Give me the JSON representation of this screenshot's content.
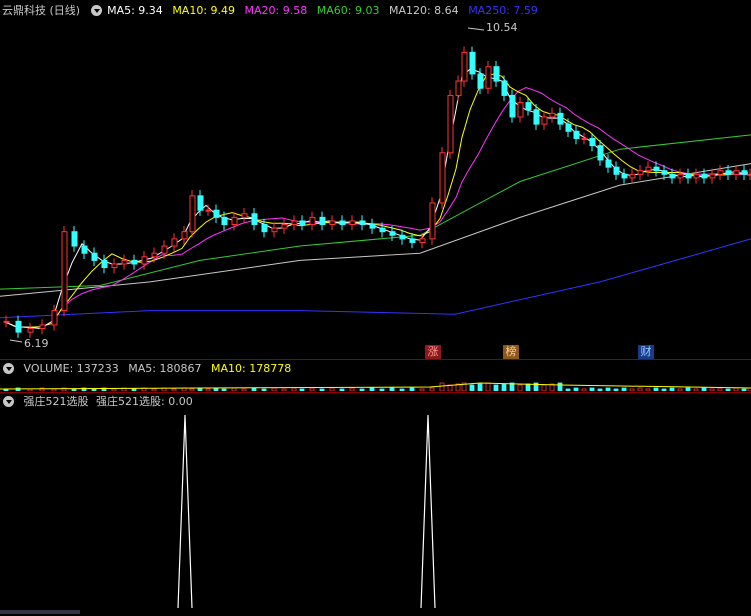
{
  "title": "云鼎科技 (日线)",
  "ma": [
    {
      "label": "MA5: 9.34",
      "color": "#ffffff"
    },
    {
      "label": "MA10: 9.49",
      "color": "#ffff00"
    },
    {
      "label": "MA20: 9.58",
      "color": "#ff33ff"
    },
    {
      "label": "MA60: 9.03",
      "color": "#33cc33"
    },
    {
      "label": "MA120: 8.64",
      "color": "#c8c8c8"
    },
    {
      "label": "MA250: 7.59",
      "color": "#3333ff"
    }
  ],
  "price": {
    "high_label": "10.54",
    "low_label": "6.19"
  },
  "markers": [
    {
      "text": "涨",
      "bg": "#8b1a1a",
      "color": "#ff9999"
    },
    {
      "text": "榜",
      "bg": "#8b5a1a",
      "color": "#ffcc99"
    },
    {
      "text": "财",
      "bg": "#1a3a8b",
      "color": "#99ccff"
    }
  ],
  "volume": {
    "label": "VOLUME: 137233",
    "ma5": "MA5: 180867",
    "ma10": "MA10: 178778"
  },
  "indicator": {
    "name": "强庄521选股",
    "value": "强庄521选股: 0.00",
    "spikes": [
      185,
      428
    ]
  },
  "colors": {
    "up": "#ff3333",
    "down": "#33ffff",
    "divider": "#8b0000"
  }
}
